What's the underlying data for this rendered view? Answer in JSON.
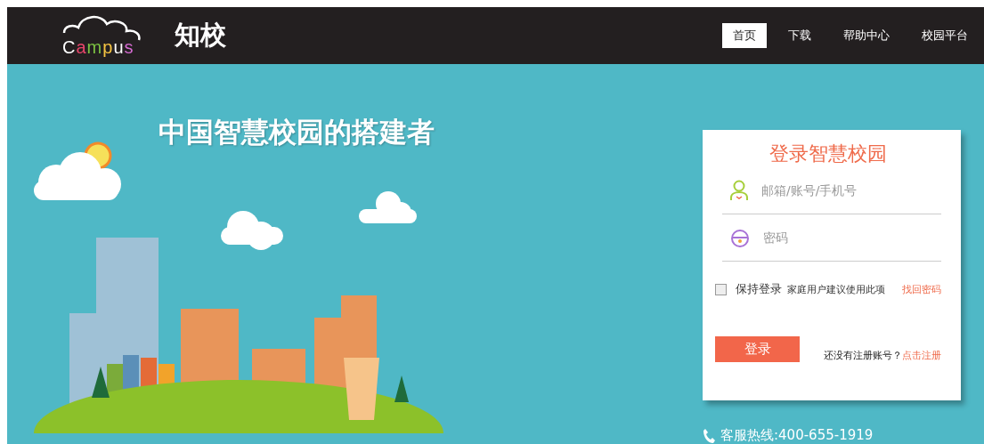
{
  "logo": {
    "letters": [
      {
        "text": "C",
        "color": "#ffffff"
      },
      {
        "text": "a",
        "color": "#e8456a"
      },
      {
        "text": "m",
        "color": "#7cc242"
      },
      {
        "text": "p",
        "color": "#f5c342"
      },
      {
        "text": "u",
        "color": "#ffffff"
      },
      {
        "text": "s",
        "color": "#d46bd0"
      }
    ],
    "name": "知校"
  },
  "nav": [
    {
      "label": "首页",
      "selected": true
    },
    {
      "label": "下载",
      "selected": false
    },
    {
      "label": "帮助中心",
      "selected": false
    },
    {
      "label": "校园平台",
      "selected": false
    }
  ],
  "hero": {
    "headline": "中国智慧校园的搭建者"
  },
  "login": {
    "title": "登录智慧校园",
    "fields": [
      {
        "kind": "user",
        "placeholder": "邮箱/账号/手机号"
      },
      {
        "kind": "password",
        "placeholder": "密码"
      }
    ],
    "remember": {
      "label": "保持登录",
      "checked": false,
      "hint": "家庭用户建议使用此项"
    },
    "forgot": "找回密码",
    "submit": "登录",
    "register_prompt": "还没有注册账号？",
    "register_link": "点击注册"
  },
  "hotline": "客服热线:400-655-1919"
}
